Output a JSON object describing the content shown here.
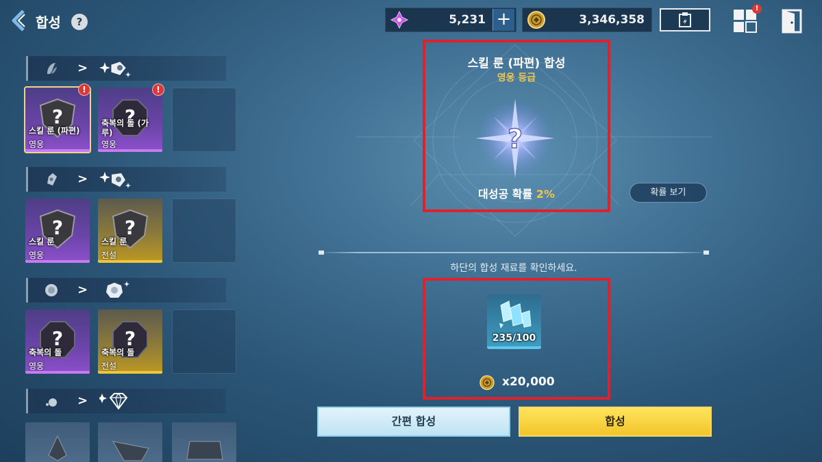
{
  "header": {
    "title": "합성",
    "help": "?"
  },
  "currency": {
    "gem": "5,231",
    "gold": "3,346,358"
  },
  "left_list": {
    "groups": [
      {
        "items": [
          {
            "name": "스킬 룬 (파편)",
            "grade": "영웅",
            "alert": "!"
          },
          {
            "name": "축복의 돌 (가루)",
            "grade": "영웅",
            "alert": "!"
          }
        ]
      },
      {
        "items": [
          {
            "name": "스킬 룬",
            "grade": "영웅"
          },
          {
            "name": "스킬 룬",
            "grade": "전설"
          }
        ]
      },
      {
        "items": [
          {
            "name": "축복의 돌",
            "grade": "영웅"
          },
          {
            "name": "축복의 돌",
            "grade": "전설"
          }
        ]
      }
    ]
  },
  "result": {
    "title": "스킬 룬 (파편) 합성",
    "grade": "영웅 등급",
    "rate_label": "대성공 확률",
    "rate_value": "2%",
    "prob_button": "확률 보기"
  },
  "materials": {
    "hint": "하단의 합성 재료를 확인하세요.",
    "count": "235/100",
    "cost": "x20,000"
  },
  "actions": {
    "quick": "간편 합성",
    "synth": "합성"
  },
  "colors": {
    "hero": "#8a4fc8",
    "legend": "#f2c437",
    "highlight_frame": "#e0202a",
    "accent_gold": "#f3c64b"
  }
}
